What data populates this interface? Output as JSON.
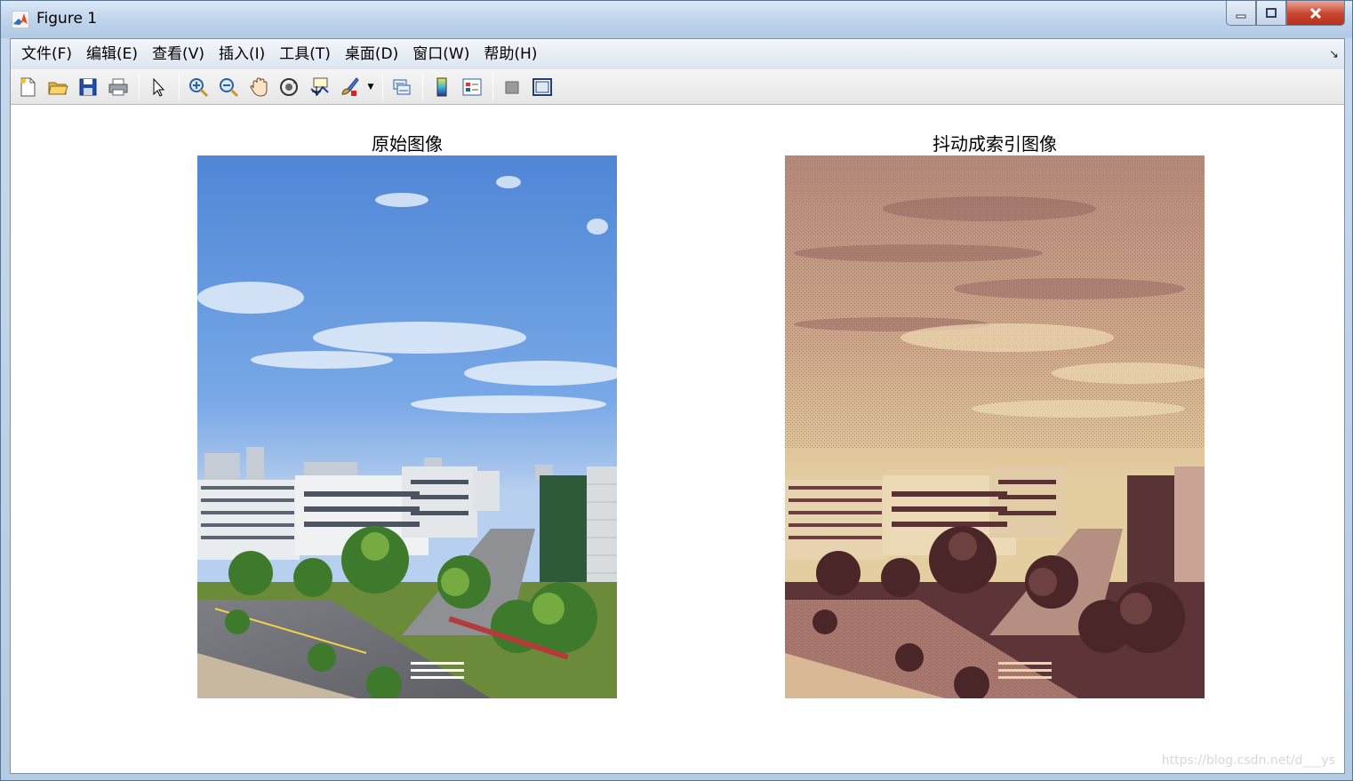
{
  "window": {
    "title": "Figure 1",
    "icon": "matlab-logo-icon"
  },
  "menu": [
    {
      "label": "文件(F)"
    },
    {
      "label": "编辑(E)"
    },
    {
      "label": "查看(V)"
    },
    {
      "label": "插入(I)"
    },
    {
      "label": "工具(T)"
    },
    {
      "label": "桌面(D)"
    },
    {
      "label": "窗口(W)"
    },
    {
      "label": "帮助(H)"
    }
  ],
  "toolbar": {
    "icons": [
      "new-figure-icon",
      "open-file-icon",
      "save-icon",
      "print-icon",
      "pointer-icon",
      "zoom-in-icon",
      "zoom-out-icon",
      "pan-hand-icon",
      "rotate-3d-icon",
      "data-cursor-icon",
      "brush-icon",
      "link-plot-icon",
      "colorbar-icon",
      "legend-icon",
      "hide-plot-tools-icon",
      "show-plot-tools-icon"
    ]
  },
  "figure": {
    "left_title": "原始图像",
    "right_title": "抖动成索引图像"
  },
  "watermark": "https://blog.csdn.net/d___ys"
}
